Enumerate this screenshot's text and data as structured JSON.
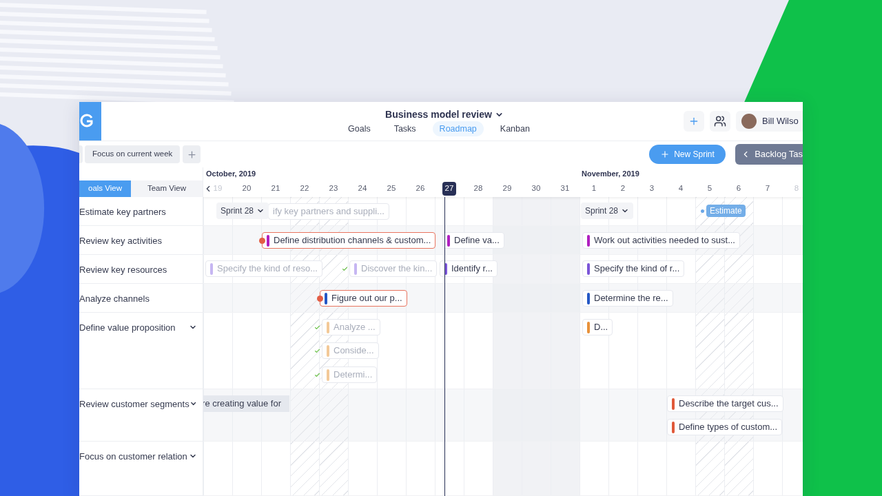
{
  "header": {
    "title": "Business model review",
    "tabs": [
      {
        "label": "Goals",
        "selected": false
      },
      {
        "label": "Tasks",
        "selected": false
      },
      {
        "label": "Roadmap",
        "selected": true
      },
      {
        "label": "Kanban",
        "selected": false
      }
    ],
    "user": "Bill Wilso"
  },
  "toolbar": {
    "filter": "Focus on current week",
    "new_sprint": "New Sprint",
    "backlog": "Backlog Tas"
  },
  "months": [
    "October, 2019",
    "November, 2019"
  ],
  "views": [
    {
      "label": "oals View",
      "selected": true
    },
    {
      "label": "Team View",
      "selected": false
    }
  ],
  "days": [
    {
      "label": "19",
      "dim": true,
      "selected": false,
      "kind": "plain"
    },
    {
      "label": "20",
      "dim": false,
      "selected": false,
      "kind": "plain"
    },
    {
      "label": "21",
      "dim": false,
      "selected": false,
      "kind": "plain"
    },
    {
      "label": "22",
      "dim": false,
      "selected": false,
      "kind": "hatched"
    },
    {
      "label": "23",
      "dim": false,
      "selected": false,
      "kind": "hatched"
    },
    {
      "label": "24",
      "dim": false,
      "selected": false,
      "kind": "plain"
    },
    {
      "label": "25",
      "dim": false,
      "selected": false,
      "kind": "plain"
    },
    {
      "label": "26",
      "dim": false,
      "selected": false,
      "kind": "plain"
    },
    {
      "label": "27",
      "dim": false,
      "selected": true,
      "kind": "plain"
    },
    {
      "label": "28",
      "dim": false,
      "selected": false,
      "kind": "plain"
    },
    {
      "label": "29",
      "dim": false,
      "selected": false,
      "kind": "shaded"
    },
    {
      "label": "30",
      "dim": false,
      "selected": false,
      "kind": "shaded"
    },
    {
      "label": "31",
      "dim": false,
      "selected": false,
      "kind": "shaded"
    },
    {
      "label": "1",
      "dim": false,
      "selected": false,
      "kind": "plain"
    },
    {
      "label": "2",
      "dim": false,
      "selected": false,
      "kind": "plain"
    },
    {
      "label": "3",
      "dim": false,
      "selected": false,
      "kind": "plain"
    },
    {
      "label": "4",
      "dim": false,
      "selected": false,
      "kind": "plain"
    },
    {
      "label": "5",
      "dim": false,
      "selected": false,
      "kind": "hatched"
    },
    {
      "label": "6",
      "dim": false,
      "selected": false,
      "kind": "hatched"
    },
    {
      "label": "7",
      "dim": false,
      "selected": false,
      "kind": "plain"
    },
    {
      "label": "8",
      "dim": true,
      "selected": false,
      "kind": "plain"
    }
  ],
  "goals": [
    {
      "label": "Estimate key partners",
      "expandable": false,
      "items": [
        {
          "kind": "sprint",
          "text": "Sprint 28"
        },
        {
          "kind": "task",
          "text": "ify key partners and suppli...",
          "done": true,
          "overdue": false
        },
        {
          "kind": "sprint",
          "text": "Sprint 28"
        },
        {
          "kind": "badge",
          "text": "Estimate"
        }
      ]
    },
    {
      "label": "Review key activities",
      "expandable": false,
      "items": [
        {
          "kind": "task",
          "text": "Define distribution channels & custom...",
          "color": "#b01fc0",
          "done": false,
          "overdue": true
        },
        {
          "kind": "task",
          "text": "Define va...",
          "color": "#b01fc0",
          "done": false,
          "overdue": false
        },
        {
          "kind": "task",
          "text": "Work out activities needed to sust...",
          "color": "#b01fc0",
          "done": false,
          "overdue": false
        }
      ]
    },
    {
      "label": "Review key resources",
      "expandable": false,
      "items": [
        {
          "kind": "task",
          "text": "Specify the kind of reso...",
          "color": "#c6b6f2",
          "done": true,
          "overdue": false
        },
        {
          "kind": "task",
          "text": "Discover the kin...",
          "color": "#c6b6f2",
          "done": true,
          "overdue": false
        },
        {
          "kind": "task",
          "text": "Identify r...",
          "color": "#7b55d8",
          "done": false,
          "overdue": false
        },
        {
          "kind": "task",
          "text": "Specify the kind of r...",
          "color": "#7b55d8",
          "done": false,
          "overdue": false
        }
      ]
    },
    {
      "label": "Analyze channels",
      "expandable": false,
      "items": [
        {
          "kind": "task",
          "text": "Figure out our p...",
          "color": "#2457c5",
          "done": false,
          "overdue": true
        },
        {
          "kind": "task",
          "text": "Determine the re...",
          "color": "#2457c5",
          "done": false,
          "overdue": false
        }
      ]
    },
    {
      "label": "Define value proposition",
      "expandable": true,
      "items": [
        {
          "kind": "task",
          "text": "Analyze ...",
          "color": "#f3c998",
          "done": true,
          "overdue": false
        },
        {
          "kind": "task",
          "text": "Conside...",
          "color": "#f3c998",
          "done": true,
          "overdue": false
        },
        {
          "kind": "task",
          "text": "Determi...",
          "color": "#f3c998",
          "done": true,
          "overdue": false
        },
        {
          "kind": "task",
          "text": "D...",
          "color": "#e8913a",
          "done": false,
          "overdue": false
        }
      ]
    },
    {
      "label": "Review customer segments",
      "expandable": true,
      "items": [
        {
          "kind": "bar",
          "text": "re creating value for"
        },
        {
          "kind": "task",
          "text": "Describe the target cus...",
          "color": "#e0593a",
          "done": false,
          "overdue": false
        },
        {
          "kind": "task",
          "text": "Define types of custom...",
          "color": "#e0593a",
          "done": false,
          "overdue": false
        }
      ]
    },
    {
      "label": "Focus on customer relation",
      "expandable": true
    }
  ]
}
